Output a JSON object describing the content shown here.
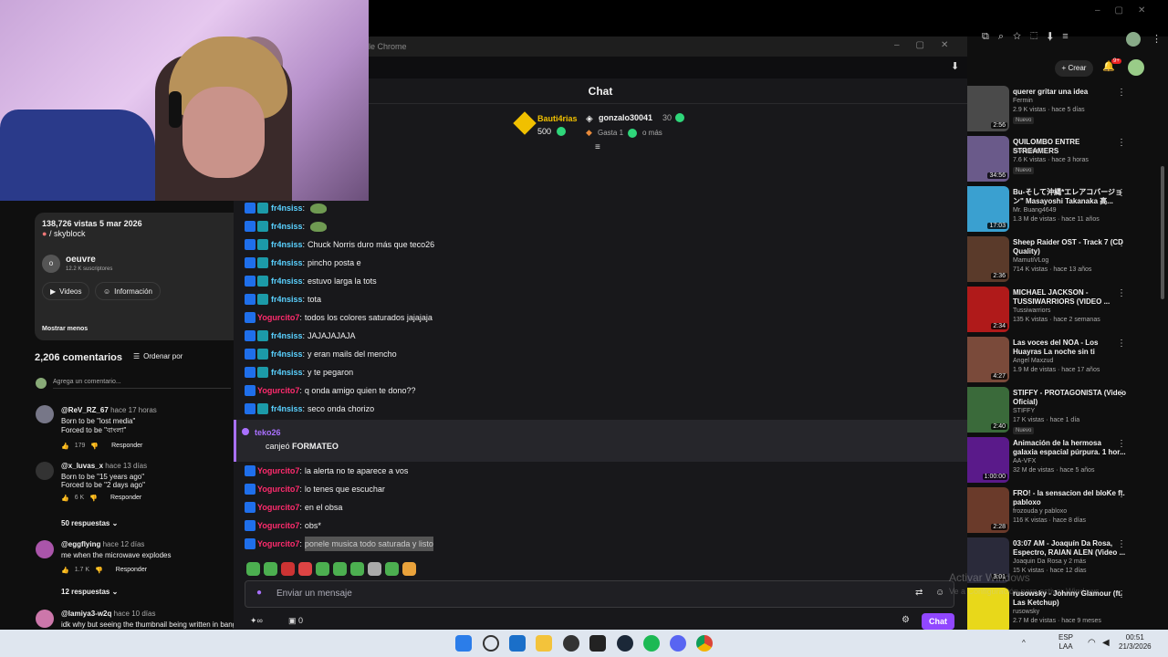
{
  "popup": {
    "title": "le Chrome"
  },
  "chat": {
    "title": "Chat",
    "leaders": [
      {
        "name": "Bauti4rias",
        "points": "500"
      },
      {
        "name": "gonzalo30041",
        "points": "30"
      }
    ],
    "gasta": "Gasta 1",
    "o_mas": "o más",
    "messages": [
      {
        "user": "fr4nsiss",
        "text": "",
        "emote": true,
        "color": "blue"
      },
      {
        "user": "fr4nsiss",
        "text": "",
        "emote": true,
        "color": "blue"
      },
      {
        "user": "fr4nsiss",
        "text": "Chuck Norris duro más que teco26",
        "color": "blue"
      },
      {
        "user": "fr4nsiss",
        "text": "pincho posta e",
        "color": "blue"
      },
      {
        "user": "fr4nsiss",
        "text": "estuvo larga la tots",
        "color": "blue"
      },
      {
        "user": "fr4nsiss",
        "text": "tota",
        "color": "blue"
      },
      {
        "user": "Yogurcito7",
        "text": "todos los colores saturados jajajaja",
        "color": "pink"
      },
      {
        "user": "fr4nsiss",
        "text": "JAJAJAJAJA",
        "color": "blue"
      },
      {
        "user": "fr4nsiss",
        "text": "y eran mails del mencho",
        "color": "blue"
      },
      {
        "user": "fr4nsiss",
        "text": "y te pegaron",
        "color": "blue"
      },
      {
        "user": "Yogurcito7",
        "text": "q onda amigo quien te dono??",
        "color": "pink"
      },
      {
        "user": "fr4nsiss",
        "text": "seco onda chorizo",
        "color": "blue"
      }
    ],
    "redeem": {
      "user": "teko26",
      "action": "canjeó",
      "reward": "FORMATEO"
    },
    "messages2": [
      {
        "user": "Yogurcito7",
        "text": "la alerta no te aparece a vos"
      },
      {
        "user": "Yogurcito7",
        "text": "lo tenes que escuchar"
      },
      {
        "user": "Yogurcito7",
        "text": "en el obsa"
      },
      {
        "user": "Yogurcito7",
        "text": "obs*"
      },
      {
        "user": "Yogurcito7",
        "text": "ponele musica todo saturada y listo"
      }
    ],
    "input_placeholder": "Enviar un mensaje",
    "chat_button": "Chat",
    "viewers": "0"
  },
  "yt_left": {
    "views_date": "138,726 vistas  5 mar 2026",
    "tag": "/ skyblock",
    "channel": "oeuvre",
    "subs": "12.2 K suscriptores",
    "videos_btn": "Videos",
    "info_btn": "Información",
    "show_less": "Mostrar menos",
    "comments_count": "2,206 comentarios",
    "sort_by": "Ordenar por",
    "add_comment": "Agrega un comentario...",
    "comments": [
      {
        "user": "@ReV_RZ_67",
        "when": "hace 17 horas",
        "lines": [
          "Born to be \"lost media\"",
          "Forced to be \"বাংলা\""
        ],
        "likes": "179",
        "reply": "Responder"
      },
      {
        "user": "@x_luvas_x",
        "when": "hace 13 días",
        "lines": [
          "Born to be \"15 years ago\"",
          "Forced to be \"2 days ago\""
        ],
        "likes": "6 K",
        "reply": "Responder"
      },
      {
        "user": "@eggflying",
        "when": "hace 12 días",
        "lines": [
          "me when the microwave explodes"
        ],
        "likes": "1.7 K",
        "reply": "Responder"
      },
      {
        "user": "@lamiya3-w2q",
        "when": "hace 10 días",
        "lines": [
          "idk why but seeing the thumbnail being written in bangla"
        ],
        "likes": "",
        "reply": ""
      }
    ],
    "replies1": "50 respuestas",
    "replies2": "12 respuestas"
  },
  "yt_right": {
    "create": "Crear",
    "notif": "9+",
    "videos": [
      {
        "title": "querer gritar una idea",
        "channel": "Fermin",
        "meta": "2.9 K vistas · hace 5 días",
        "dur": "2:56",
        "nuevo": "Nuevo",
        "color": "#4a4a4a"
      },
      {
        "title": "QUILOMBO ENTRE STREAMERS",
        "channel": "Nachoide3",
        "meta": "7.6 K vistas · hace 3 horas",
        "dur": "34:56",
        "nuevo": "Nuevo",
        "color": "#6a5a8a"
      },
      {
        "title": "Bu-そして沖縄*エレアコバージョン\" Masayoshi Takanaka 高...",
        "channel": "Mr. Buang4649",
        "meta": "1.3 M de vistas · hace 11 años",
        "dur": "17:03",
        "nuevo": "",
        "color": "#3aa0d0"
      },
      {
        "title": "Sheep Raider OST - Track 7 (CD Quality)",
        "channel": "MamutiVLog",
        "meta": "714 K vistas · hace 13 años",
        "dur": "2:36",
        "nuevo": "",
        "color": "#5a3a2a"
      },
      {
        "title": "MICHAEL JACKSON - TUSSIWARRIORS (VIDEO ...",
        "channel": "Tussiwarriors",
        "meta": "135 K vistas · hace 2 semanas",
        "dur": "2:34",
        "nuevo": "",
        "color": "#b01a1a"
      },
      {
        "title": "Las voces del NOA - Los Huayras   La noche sin ti",
        "channel": "Angel Maxzud",
        "meta": "1.9 M de vistas · hace 17 años",
        "dur": "4:27",
        "nuevo": "",
        "color": "#7a4a3a"
      },
      {
        "title": "STIFFY - PROTAGONISTA (Video Oficial)",
        "channel": "STIFFY",
        "meta": "17 K vistas · hace 1 día",
        "dur": "2:40",
        "nuevo": "Nuevo",
        "color": "#3a6a3a"
      },
      {
        "title": "Animación de la hermosa galaxia espacial púrpura. 1 hor...",
        "channel": "AA-VFX",
        "meta": "32 M de vistas · hace 5 años",
        "dur": "1:00:00",
        "nuevo": "",
        "color": "#5a1a8a"
      },
      {
        "title": "FRO! - la sensacion del bloKe ft. pabloxo",
        "channel": "frozouda y pabloxo",
        "meta": "116 K vistas · hace 8 días",
        "dur": "2:28",
        "nuevo": "",
        "color": "#6a3a2a"
      },
      {
        "title": "03:07 AM - Joaquín Da Rosa, Espectro, RAIAN ALEN (Video ...",
        "channel": "Joaquin Da Rosa y 2 más",
        "meta": "15 K vistas · hace 12 días",
        "dur": "3:01",
        "nuevo": "",
        "color": "#2a2a3a"
      },
      {
        "title": "rusowsky - Johnny Glamour (ft. Las Ketchup)",
        "channel": "rusowsky",
        "meta": "2.7 M de vistas · hace 9 meses",
        "dur": "",
        "nuevo": "",
        "color": "#e8d81a"
      }
    ]
  },
  "watermark": {
    "line1": "Activar Windows",
    "line2": "Ve a Configuración para activar Windows."
  },
  "taskbar": {
    "lang": "ESP",
    "lang2": "LAA",
    "time": "00:51",
    "date": "21/3/2026"
  }
}
